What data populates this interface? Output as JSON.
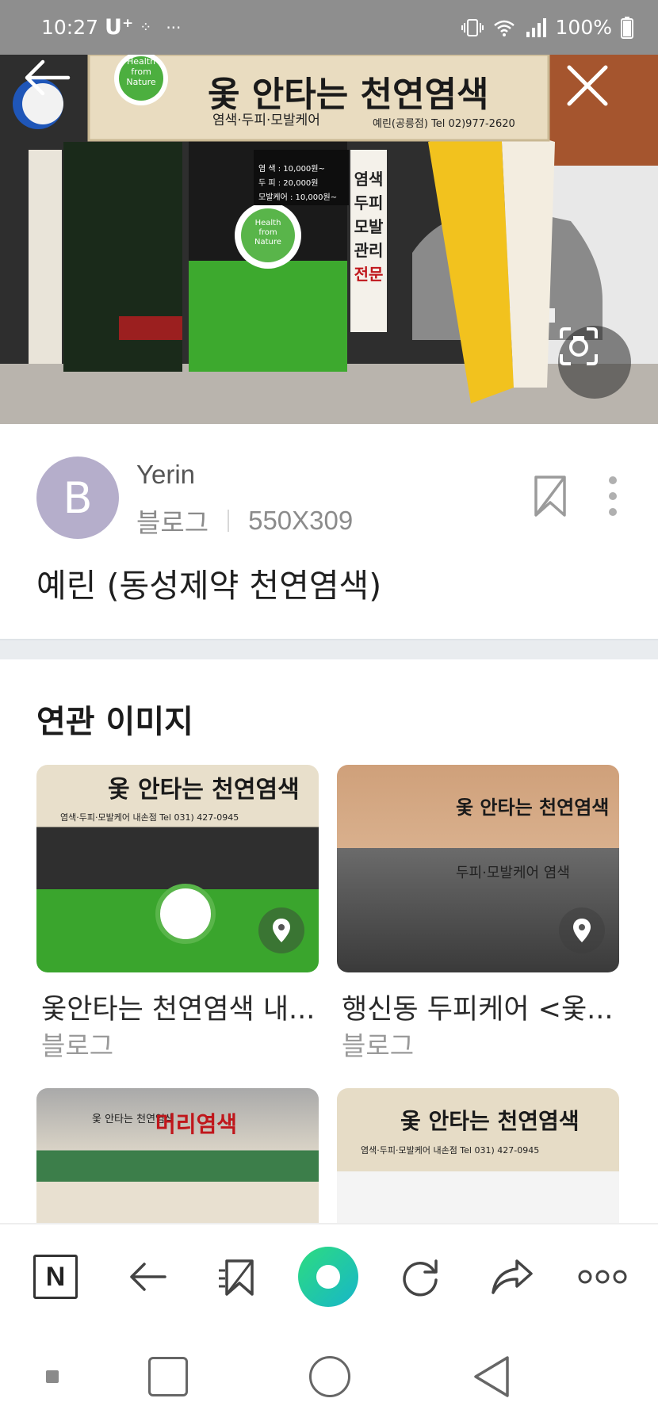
{
  "status_bar": {
    "time": "10:27",
    "carrier": "U⁺",
    "dots": "···",
    "battery": "100%"
  },
  "hero": {
    "sign_main": "옻 안타는 천연염색",
    "sign_sub": "염색·두피·모발케어",
    "sign_contact": "예린(공릉점) Tel 02)977-2620",
    "logo_text": "Health from Nature",
    "side_sign": [
      "염색",
      "두피",
      "모발",
      "관리",
      "전문"
    ],
    "price_lines": [
      "염   색 : 10,000원~",
      "두   피 : 20,000원",
      "모발케어 : 10,000원~"
    ]
  },
  "info": {
    "avatar_letter": "B",
    "author": "Yerin",
    "source": "블로그",
    "dimensions": "550X309",
    "title": "예린 (동성제약 천연염색)"
  },
  "related": {
    "heading": "연관 이미지",
    "items": [
      {
        "title": "옻안타는 천연염색 내...",
        "source": "블로그",
        "sign": "옻 안타는 천연염색",
        "sub": "염색·두피·모발케어   내손점  Tel 031) 427-0945"
      },
      {
        "title": "행신동 두피케어 <옻...",
        "source": "블로그",
        "sign": "옻 안타는 천연염색",
        "sub": "두피·모발케어 염색"
      },
      {
        "title": "",
        "source": "",
        "sign": "머리염색",
        "sub": "옻 안타는 천연염색"
      },
      {
        "title": "",
        "source": "",
        "sign": "옻 안타는 천연염색",
        "sub": "염색·두피·모발케어   내손점  Tel 031) 427-0945"
      }
    ]
  },
  "colors": {
    "accent_green": "#1fc88a",
    "avatar_bg": "#b5aecb",
    "status_bar": "#8e8e8e"
  },
  "icons": {
    "back": "back-arrow-icon",
    "close": "close-icon",
    "lens": "camera-lens-icon",
    "bookmark": "bookmark-icon",
    "more": "more-vertical-icon",
    "pin": "location-pin-icon"
  },
  "toolbar": {
    "naver_label": "N"
  }
}
